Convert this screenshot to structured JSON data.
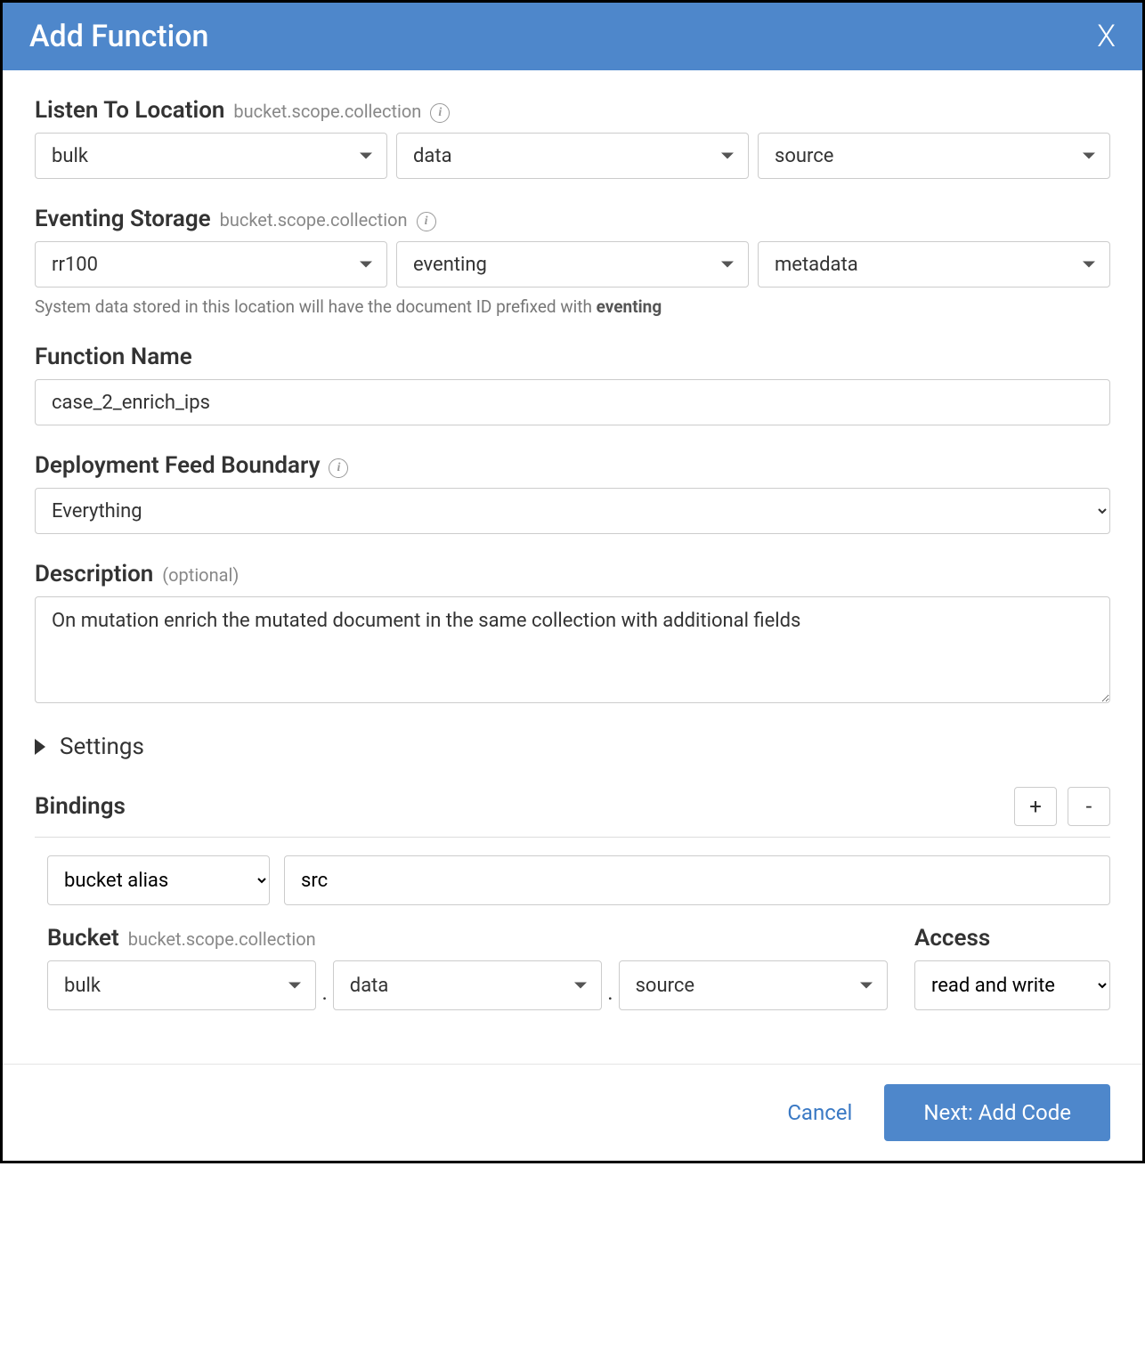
{
  "header": {
    "title": "Add Function",
    "close": "X"
  },
  "listen": {
    "label": "Listen To Location",
    "hint": "bucket.scope.collection",
    "bucket": "bulk",
    "scope": "data",
    "collection": "source"
  },
  "storage": {
    "label": "Eventing Storage",
    "hint": "bucket.scope.collection",
    "bucket": "rr100",
    "scope": "eventing",
    "collection": "metadata",
    "help_prefix": "System data stored in this location will have the document ID prefixed with ",
    "help_strong": "eventing"
  },
  "functionName": {
    "label": "Function Name",
    "value": "case_2_enrich_ips"
  },
  "boundary": {
    "label": "Deployment Feed Boundary",
    "value": "Everything"
  },
  "description": {
    "label": "Description",
    "optional": "(optional)",
    "value": "On mutation enrich the mutated document in the same collection with additional fields"
  },
  "settings": {
    "label": "Settings"
  },
  "bindings": {
    "label": "Bindings",
    "add": "+",
    "remove": "-",
    "aliasType": "bucket alias",
    "aliasName": "src",
    "bucketLabel": "Bucket",
    "bucketHint": "bucket.scope.collection",
    "bucket": "bulk",
    "scope": "data",
    "collection": "source",
    "accessLabel": "Access",
    "accessValue": "read and write"
  },
  "footer": {
    "cancel": "Cancel",
    "next": "Next: Add Code"
  }
}
